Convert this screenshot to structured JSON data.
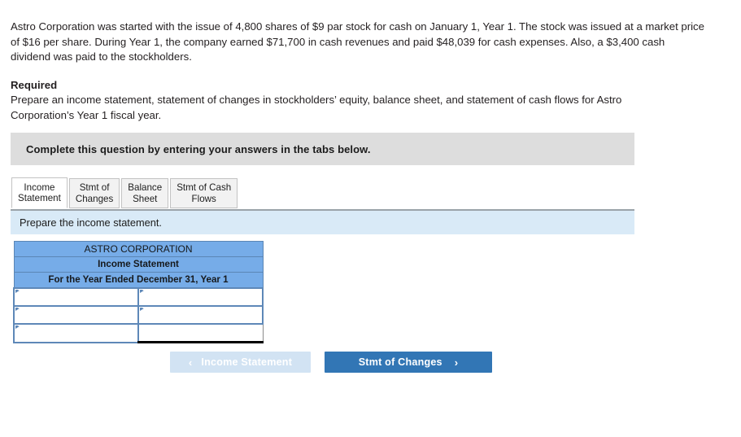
{
  "problem": {
    "text": "Astro Corporation was started with the issue of 4,800 shares of $9 par stock for cash on January 1, Year 1. The stock was issued at a market price of $16 per share. During Year 1, the company earned $71,700 in cash revenues and paid $48,039 for cash expenses. Also, a $3,400 cash dividend was paid to the stockholders."
  },
  "required": {
    "title": "Required",
    "body": "Prepare an income statement, statement of changes in stockholders’ equity, balance sheet, and statement of cash flows for Astro Corporation’s Year 1 fiscal year."
  },
  "banner": {
    "text": "Complete this question by entering your answers in the tabs below."
  },
  "tabs": [
    {
      "line1": "Income",
      "line2": "Statement",
      "active": true
    },
    {
      "line1": "Stmt of",
      "line2": "Changes",
      "active": false
    },
    {
      "line1": "Balance",
      "line2": "Sheet",
      "active": false
    },
    {
      "line1": "Stmt of Cash",
      "line2": "Flows",
      "active": false
    }
  ],
  "instruction": {
    "text": "Prepare the income statement."
  },
  "statement": {
    "header_rows": [
      "ASTRO CORPORATION",
      "Income Statement",
      "For the Year Ended December 31, Year 1"
    ],
    "rows": [
      {
        "label": "",
        "amount": ""
      },
      {
        "label": "",
        "amount": ""
      },
      {
        "label": "",
        "amount": ""
      }
    ]
  },
  "nav": {
    "prev_label": "Income Statement",
    "prev_chevron": "‹",
    "next_label": "Stmt of Changes",
    "next_chevron": "›"
  },
  "colors": {
    "banner_gray": "#dddddd",
    "instruction_blue": "#d9eaf7",
    "table_header_blue": "#76ace8",
    "table_border_blue": "#5e88b8",
    "button_active_blue": "#3276b5",
    "button_disabled_blue": "#d2e3f3"
  }
}
